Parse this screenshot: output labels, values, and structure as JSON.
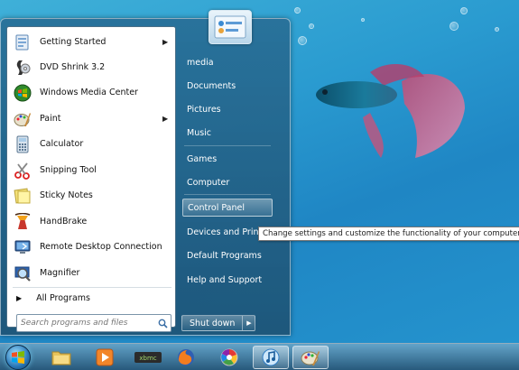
{
  "start_menu": {
    "programs": [
      {
        "label": "Getting Started",
        "icon": "getting-started-icon",
        "has_submenu": true
      },
      {
        "label": "DVD Shrink 3.2",
        "icon": "dvd-shrink-icon",
        "has_submenu": false
      },
      {
        "label": "Windows Media Center",
        "icon": "media-center-icon",
        "has_submenu": false
      },
      {
        "label": "Paint",
        "icon": "paint-icon",
        "has_submenu": true
      },
      {
        "label": "Calculator",
        "icon": "calculator-icon",
        "has_submenu": false
      },
      {
        "label": "Snipping Tool",
        "icon": "snipping-tool-icon",
        "has_submenu": false
      },
      {
        "label": "Sticky Notes",
        "icon": "sticky-notes-icon",
        "has_submenu": false
      },
      {
        "label": "HandBrake",
        "icon": "handbrake-icon",
        "has_submenu": false
      },
      {
        "label": "Remote Desktop Connection",
        "icon": "remote-desktop-icon",
        "has_submenu": false
      },
      {
        "label": "Magnifier",
        "icon": "magnifier-icon",
        "has_submenu": false
      }
    ],
    "all_programs": "All Programs",
    "search_placeholder": "Search programs and files",
    "right_items": [
      {
        "label": "media"
      },
      {
        "label": "Documents"
      },
      {
        "label": "Pictures"
      },
      {
        "label": "Music"
      },
      {
        "label": "Games"
      },
      {
        "label": "Computer"
      },
      {
        "label": "Control Panel"
      },
      {
        "label": "Devices and Printers"
      },
      {
        "label": "Default Programs"
      },
      {
        "label": "Help and Support"
      }
    ],
    "shutdown_label": "Shut down"
  },
  "tooltip": "Change settings and customize the functionality of your computer.",
  "taskbar": {
    "items": [
      {
        "icon": "windows-explorer-icon"
      },
      {
        "icon": "media-player-icon"
      },
      {
        "icon": "xbmc-icon"
      },
      {
        "icon": "firefox-icon"
      },
      {
        "icon": "picasa-icon"
      },
      {
        "icon": "itunes-icon"
      },
      {
        "icon": "paint-icon"
      }
    ]
  },
  "colors": {
    "desktop": "#2a9bd0",
    "highlight": "#ffffff"
  }
}
